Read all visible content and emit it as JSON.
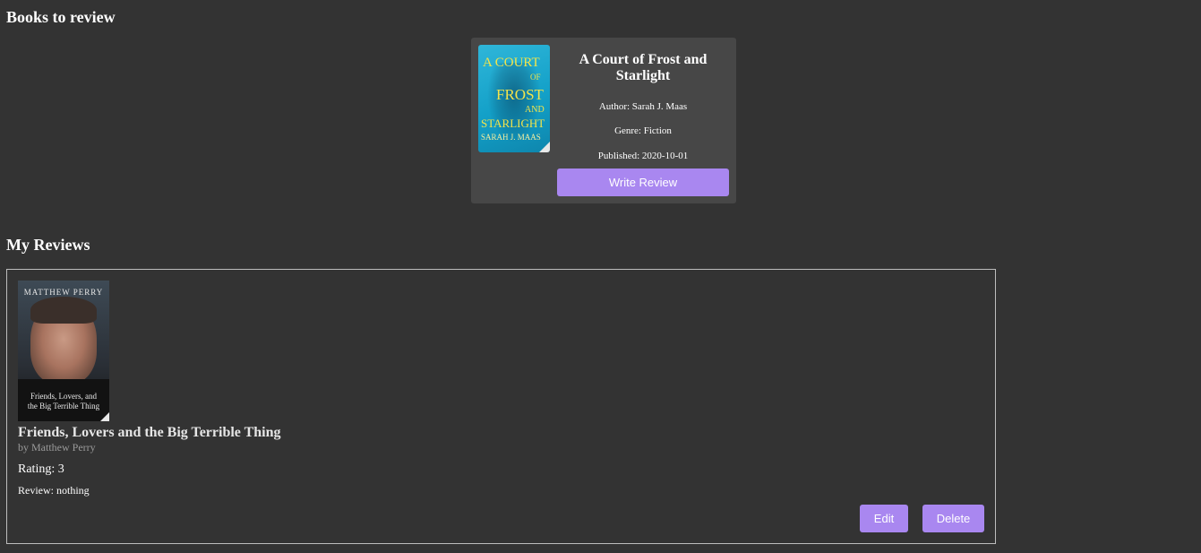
{
  "sections": {
    "books_to_review": "Books to review",
    "my_reviews": "My Reviews"
  },
  "book_card": {
    "title": "A Court of Frost and Starlight",
    "author": "Author: Sarah J. Maas",
    "genre": "Genre: Fiction",
    "published": "Published: 2020-10-01",
    "write_review_label": "Write Review",
    "cover": {
      "line1": "A COURT",
      "line2": "OF",
      "line3": "FROST",
      "line4": "AND",
      "line5": "STARLIGHT",
      "author": "SARAH J. MAAS",
      "color": "#13a0c8"
    }
  },
  "review": {
    "book_title": "Friends, Lovers and the Big Terrible Thing",
    "author": "by Matthew Perry",
    "rating": "Rating: 3",
    "review_text": "Review: nothing",
    "edit_label": "Edit",
    "delete_label": "Delete",
    "cover": {
      "author": "MATTHEW PERRY",
      "title_line1": "Friends, Lovers, and",
      "title_line2": "the Big Terrible Thing"
    }
  },
  "colors": {
    "background": "#333333",
    "card": "#474747",
    "accent": "#a987f0"
  }
}
